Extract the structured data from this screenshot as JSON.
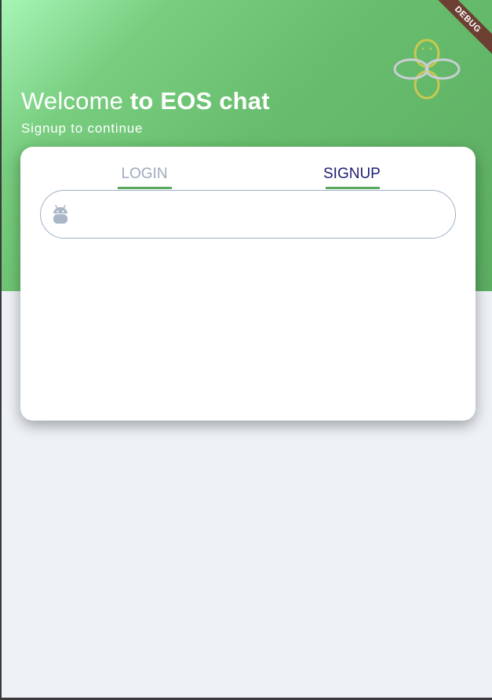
{
  "header": {
    "welcome_prefix": "Welcome ",
    "welcome_suffix": "to EOS chat",
    "subtitle": "Signup to continue"
  },
  "tabs": [
    {
      "label": "LOGIN",
      "active": false
    },
    {
      "label": "SIGNUP",
      "active": true
    }
  ],
  "form": {
    "username_icon": "android-icon",
    "username_value": "",
    "username_placeholder": ""
  },
  "debug_banner": "DEBUG",
  "logo": {
    "name": "eos-logo-icon"
  },
  "colors": {
    "header_gradient_start": "#a6f5b6",
    "header_gradient_end": "#5dad63",
    "tab_active": "#1f1f72",
    "tab_inactive": "#9eaabb",
    "tab_indicator": "#5aa85f",
    "page_background": "#eef2f7",
    "debug_banner": "#6d3f32"
  }
}
